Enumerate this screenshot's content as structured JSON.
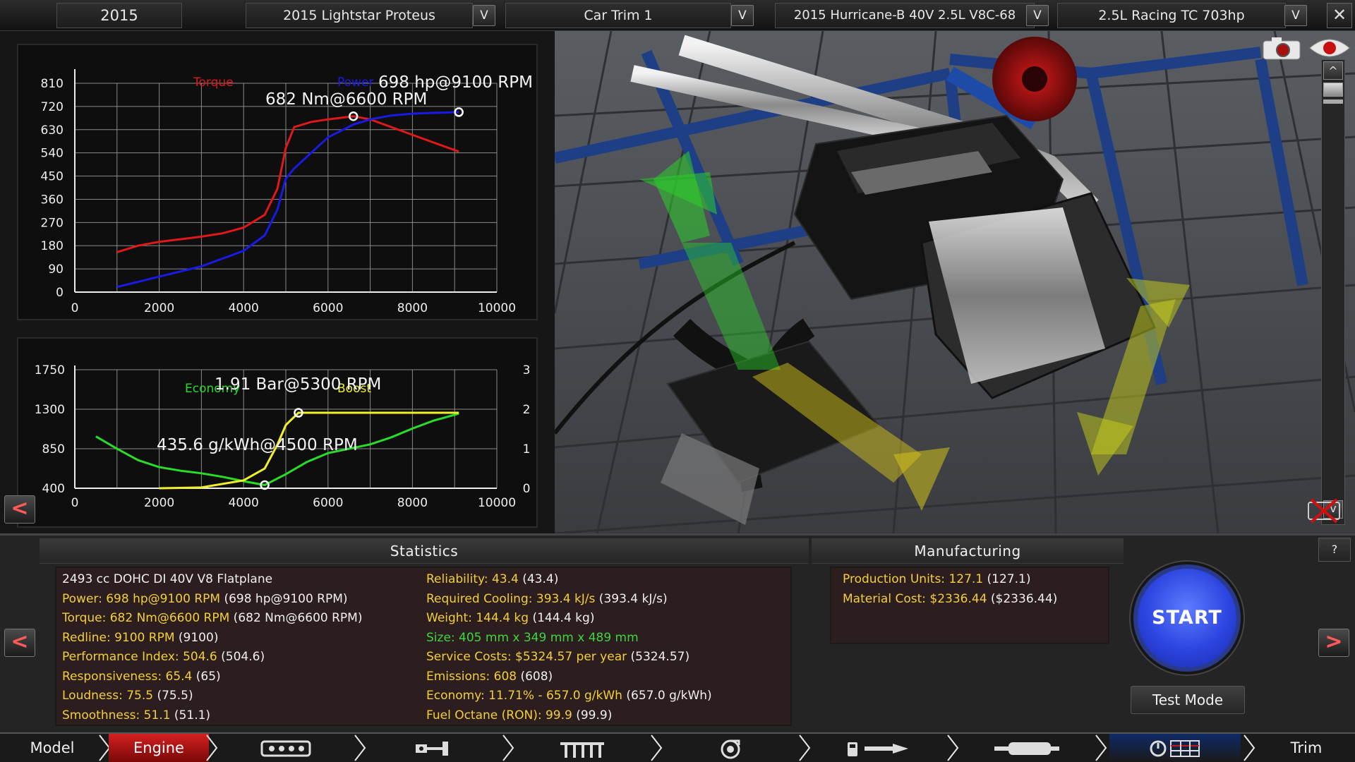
{
  "topbar": {
    "year": "2015",
    "car": "2015 Lightstar Proteus",
    "trim": "Car Trim 1",
    "engine_family": "2015 Hurricane-B 40V 2.5L V8C-68",
    "variant": "2.5L Racing TC 703hp",
    "dropdown_glyph": "V",
    "close_glyph": "✕"
  },
  "charts": {
    "power": {
      "torque_label": "Torque",
      "power_label": "Power",
      "peak_power_label": "698 hp@9100 RPM",
      "peak_torque_label": "682 Nm@6600 RPM"
    },
    "boost": {
      "economy_label": "Economy",
      "boost_label": "Boost",
      "peak_boost_label": "1.91 Bar@5300 RPM",
      "best_economy_label": "435.6 g/kWh@4500 RPM"
    }
  },
  "chart_data": [
    {
      "type": "line",
      "x_ticks": [
        0,
        2000,
        4000,
        6000,
        8000,
        10000
      ],
      "y_ticks": [
        0,
        90,
        180,
        270,
        360,
        450,
        540,
        630,
        720,
        810
      ],
      "xlim": [
        0,
        10000
      ],
      "ylim": [
        0,
        810
      ],
      "grid": true,
      "series": [
        {
          "name": "Torque",
          "color": "#e01818",
          "x": [
            1000,
            1500,
            2000,
            2500,
            3000,
            3500,
            4000,
            4500,
            4800,
            5000,
            5200,
            5600,
            6000,
            6600,
            7000,
            7500,
            8000,
            8500,
            9100
          ],
          "y": [
            155,
            180,
            195,
            205,
            215,
            228,
            250,
            300,
            400,
            560,
            640,
            660,
            670,
            682,
            670,
            640,
            610,
            580,
            545
          ]
        },
        {
          "name": "Power",
          "color": "#1a1ae8",
          "x": [
            1000,
            1500,
            2000,
            2500,
            3000,
            3500,
            4000,
            4500,
            4800,
            5000,
            5200,
            5600,
            6000,
            6600,
            7000,
            7500,
            8000,
            8500,
            9100
          ],
          "y": [
            20,
            40,
            60,
            80,
            100,
            130,
            160,
            220,
            320,
            440,
            480,
            540,
            600,
            650,
            670,
            685,
            692,
            695,
            698
          ]
        }
      ]
    },
    {
      "type": "line",
      "x_ticks": [
        0,
        2000,
        4000,
        6000,
        8000,
        10000
      ],
      "y_ticks_left": [
        400,
        850,
        1300,
        1750
      ],
      "y_ticks_right": [
        0,
        1,
        2,
        3
      ],
      "xlim": [
        0,
        10000
      ],
      "ylim_left": [
        400,
        1750
      ],
      "ylim_right": [
        0,
        3
      ],
      "grid": true,
      "series": [
        {
          "name": "Economy",
          "color": "#2adc2a",
          "axis": "left",
          "x": [
            500,
            1000,
            1500,
            2000,
            2500,
            3000,
            3500,
            4000,
            4500,
            5000,
            5500,
            6000,
            6500,
            7000,
            7500,
            8000,
            8500,
            9100
          ],
          "y": [
            990,
            850,
            720,
            640,
            600,
            570,
            530,
            480,
            436,
            560,
            700,
            800,
            850,
            900,
            980,
            1080,
            1170,
            1250
          ]
        },
        {
          "name": "Boost",
          "color": "#f0f02a",
          "axis": "right",
          "x": [
            2000,
            3000,
            4000,
            4500,
            4800,
            5000,
            5300,
            6000,
            7000,
            8000,
            9100
          ],
          "y": [
            0,
            0.02,
            0.2,
            0.5,
            1.1,
            1.6,
            1.91,
            1.91,
            1.91,
            1.91,
            1.91
          ]
        }
      ]
    }
  ],
  "statistics": {
    "title": "Statistics",
    "col1": [
      {
        "k": "2493 cc DOHC DI 40V V8 Flatplane",
        "v": "",
        "plain": true
      },
      {
        "k": "Power: 698 hp@9100 RPM",
        "v": "(698 hp@9100 RPM)"
      },
      {
        "k": "Torque: 682 Nm@6600 RPM",
        "v": "(682 Nm@6600 RPM)"
      },
      {
        "k": "Redline: 9100 RPM",
        "v": "(9100)"
      },
      {
        "k": "Performance Index: 504.6",
        "v": "(504.6)"
      },
      {
        "k": "Responsiveness: 65.4",
        "v": "(65)"
      },
      {
        "k": "Loudness: 75.5",
        "v": "(75.5)"
      },
      {
        "k": "Smoothness: 51.1",
        "v": "(51.1)"
      }
    ],
    "col2": [
      {
        "k": "Reliability: 43.4",
        "v": "(43.4)"
      },
      {
        "k": "Required Cooling: 393.4 kJ/s",
        "v": "(393.4 kJ/s)"
      },
      {
        "k": "Weight: 144.4 kg",
        "v": "(144.4 kg)"
      },
      {
        "k": "Size: 405 mm x 349 mm x 489 mm",
        "v": "",
        "green": true
      },
      {
        "k": "Service Costs: $5324.57 per year",
        "v": "(5324.57)"
      },
      {
        "k": "Emissions: 608",
        "v": "(608)"
      },
      {
        "k": "Economy: 11.71% - 657.0 g/kWh",
        "v": "(657.0 g/kWh)"
      },
      {
        "k": "Fuel Octane (RON): 99.9",
        "v": "(99.9)"
      }
    ]
  },
  "manufacturing": {
    "title": "Manufacturing",
    "lines": [
      {
        "k": "Production Units: 127.1",
        "v": "(127.1)"
      },
      {
        "k": "Material Cost: $2336.44",
        "v": "($2336.44)"
      }
    ]
  },
  "buttons": {
    "start": "START",
    "test_mode": "Test Mode",
    "help": "?",
    "prev": "<",
    "next": ">",
    "scroll_up": "^",
    "scroll_down": "v"
  },
  "nav": {
    "model": "Model",
    "engine": "Engine",
    "trim": "Trim"
  },
  "colors": {
    "torque": "#e01818",
    "power": "#1a1ae8",
    "economy": "#2adc2a",
    "boost": "#f0f02a",
    "stat_key": "#f2cf3a",
    "active_tab": "#c81818",
    "start_button": "#2c44e0"
  },
  "icons": [
    "camera-icon",
    "eye-icon",
    "engine-block-icon",
    "crankshaft-icon",
    "camshaft-icon",
    "turbo-icon",
    "fuel-system-icon",
    "exhaust-icon",
    "tuning-icon",
    "screenshot-disable-icon"
  ]
}
